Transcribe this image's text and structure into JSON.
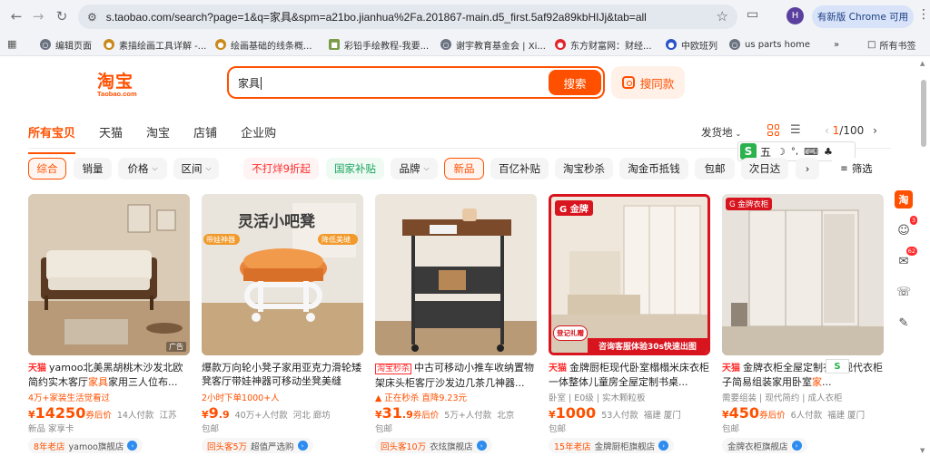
{
  "browser": {
    "url": "s.taobao.com/search?page=1&q=家具&spm=a21bo.jianhua%2Fa.201867-main.d5_first.5af92a89kbHIJj&tab=all",
    "profile_initial": "H",
    "update_label": "有新版 Chrome 可用",
    "bookmarks": [
      {
        "label": "编辑页面",
        "icon": "globe-icon"
      },
      {
        "label": "素描绘画工具详解 -...",
        "icon": "bear-icon"
      },
      {
        "label": "绘画基础的线条概...",
        "icon": "bear-icon"
      },
      {
        "label": "彩铅手绘教程-我要...",
        "icon": "image-icon"
      },
      {
        "label": "谢宇教育基金会 | Xi...",
        "icon": "globe-icon"
      },
      {
        "label": "东方财富网：财经...",
        "icon": "eastmoney-icon"
      },
      {
        "label": "中欧班列",
        "icon": "paw-icon"
      },
      {
        "label": "us parts home",
        "icon": "globe-icon"
      }
    ],
    "bookmarks_more": "»",
    "all_bookmarks": "所有书签"
  },
  "header": {
    "logo_cn": "淘宝",
    "logo_en": "Taobao.com",
    "search_value": "家具",
    "search_button": "搜索",
    "same_button": "搜同款"
  },
  "tabs": [
    {
      "label": "所有宝贝",
      "active": true
    },
    {
      "label": "天猫",
      "active": false
    },
    {
      "label": "淘宝",
      "active": false
    },
    {
      "label": "店铺",
      "active": false
    },
    {
      "label": "企业购",
      "active": false
    }
  ],
  "toolbar": {
    "ship_from": "发货地",
    "page_current": "1",
    "page_total": "/100"
  },
  "ime": {
    "logo": "S",
    "mode": "五"
  },
  "filters": {
    "items": [
      "综合",
      "销量",
      "价格",
      "区间",
      "不打烊9折起",
      "国家补贴",
      "品牌",
      "新品",
      "百亿补贴",
      "淘宝秒杀",
      "淘金币抵钱",
      "包邮",
      "次日达"
    ],
    "more": "筛选"
  },
  "products": [
    {
      "tag": "天猫",
      "title_pre": "yamoo北美黑胡桃木沙发北欧简约实木客厅",
      "title_hl": "家具",
      "title_post": "家用三人位布...",
      "sub": "4万+家装生活觉看过",
      "sub_gray": false,
      "price_int": "14250",
      "after": "券后价",
      "paid": "14人付款",
      "location": "江苏",
      "line4": "新品  家享卡",
      "store_year": "8年老店",
      "store": "yamoo旗舰店",
      "ad": "广告"
    },
    {
      "tag": "",
      "title_pre": "爆款万向轮小凳子家用亚克力滑轮矮凳客厅带娃神器可移动坐凳美缝",
      "title_hl": "",
      "title_post": "",
      "sub": "2小时下单1000+人",
      "sub_gray": false,
      "price_int": "9",
      "price_dec": ".9",
      "after": "",
      "paid": "40万+人付款",
      "location": "河北 廊坊",
      "line4": "包邮",
      "store_year": "回头客5万",
      "store": "超值严选购",
      "ad": ""
    },
    {
      "tag": "淘宝秒杀",
      "title_pre": "中古可移动小推车收纳置物架床头柜客厅沙发边几茶几神器...",
      "title_hl": "",
      "title_post": "",
      "sub": "正在秒杀 直降9.23元",
      "sub_gray": false,
      "price_int": "31",
      "price_dec": ".9",
      "after": "券后价",
      "paid": "5万+人付款",
      "location": "北京",
      "line4": "包邮",
      "store_year": "回头客10万",
      "store": "衣炫旗舰店",
      "ad": ""
    },
    {
      "tag": "天猫",
      "title_pre": "金牌厨柜现代卧室榻榻米床衣柜一体整体儿童房全屋定制书桌...",
      "title_hl": "",
      "title_post": "",
      "sub": "卧室 | E0级 | 实木颗粒板",
      "sub_gray": true,
      "price_int": "1000",
      "after": "",
      "paid": "53人付款",
      "location": "福建 厦门",
      "line4": "包邮",
      "store_year": "15年老店",
      "store": "金牌厨柜旗舰店",
      "ad": "",
      "img_badge": "金牌",
      "img_banner": "咨询客服体验30s快速出图",
      "img_gift": "登记礼赠"
    },
    {
      "tag": "天猫",
      "title_pre": "金牌衣柜全屋定制衣柜现代衣柜子简易组装家用卧室",
      "title_hl": "家",
      "title_post": "...",
      "sub": "需要组装 | 现代简约 | 成人衣柜",
      "sub_gray": true,
      "price_int": "450",
      "after": "券后价",
      "paid": "6人付款",
      "location": "福建 厦门",
      "line4": "包邮",
      "store_year": "",
      "store": "金牌衣柜旗舰店",
      "ad": "",
      "img_badge": "金牌衣柜"
    }
  ],
  "image_text": {
    "p2_headline": "灵活小吧凳",
    "p2_left": "带娃神器",
    "p2_right": "降低美缝",
    "p3_badge": "淘宝秒杀"
  },
  "rail": {
    "tao": "淘",
    "cart_badge": "3",
    "msg_badge": "62"
  },
  "colors": {
    "accent": "#ff5000",
    "tmall": "#ff2a2a",
    "green": "#19a35d"
  }
}
